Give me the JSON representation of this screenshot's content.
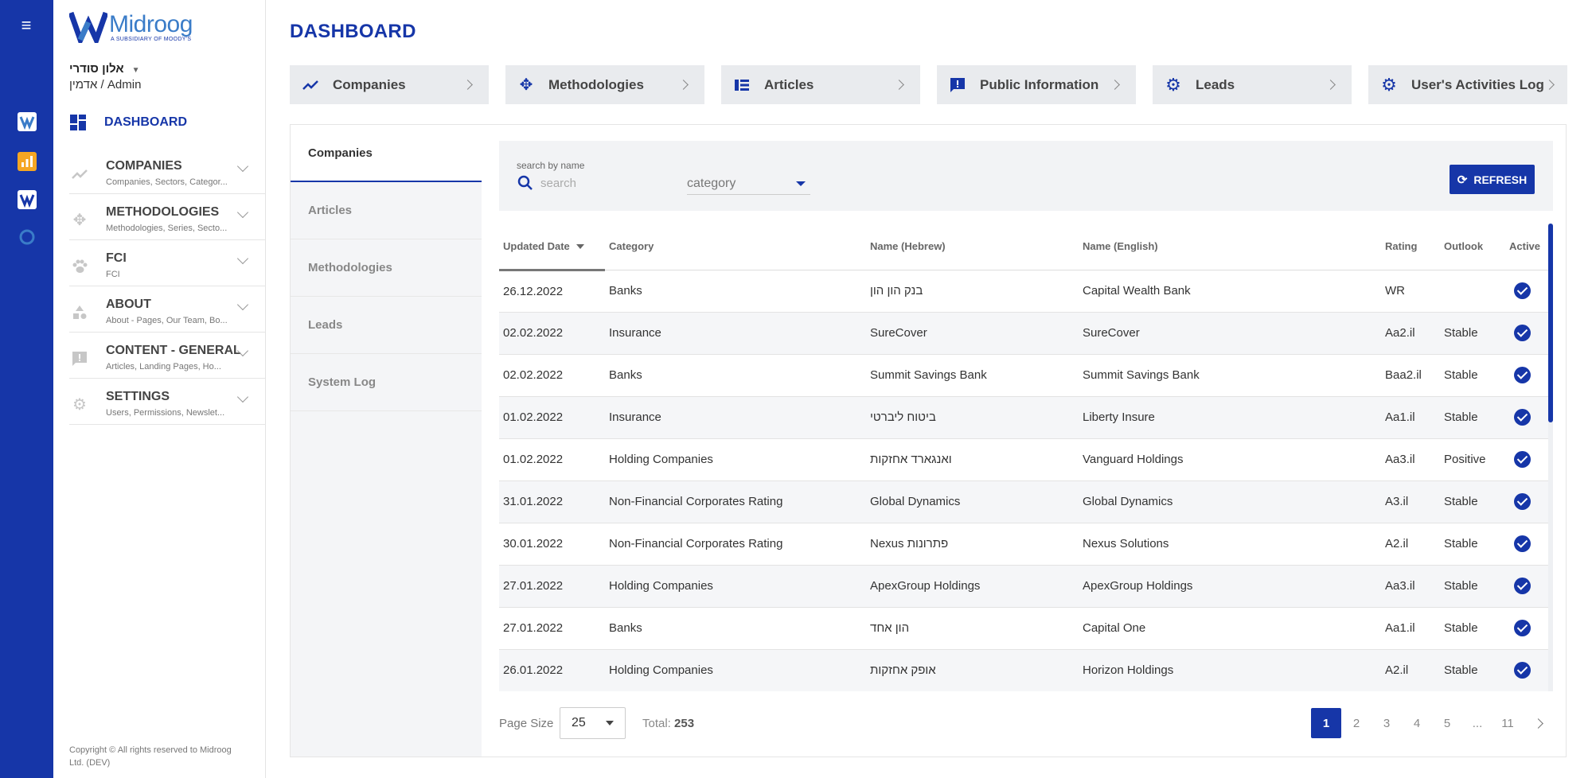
{
  "brand": {
    "name": "Midroog",
    "tagline": "A SUBSIDIARY OF MOODY'S"
  },
  "user": {
    "name": "אלון סודרי",
    "role": "אדמין / Admin"
  },
  "sidebar": {
    "dashboard_label": "DASHBOARD",
    "items": [
      {
        "title": "COMPANIES",
        "subtitle": "Companies, Sectors, Categor...",
        "icon": "trend-line-icon"
      },
      {
        "title": "METHODOLOGIES",
        "subtitle": "Methodologies, Series, Secto...",
        "icon": "move-arrows-icon"
      },
      {
        "title": "FCI",
        "subtitle": "FCI",
        "icon": "paw-icon"
      },
      {
        "title": "ABOUT",
        "subtitle": "About - Pages, Our Team, Bo...",
        "icon": "shapes-icon"
      },
      {
        "title": "CONTENT - GENERAL",
        "subtitle": "Articles, Landing Pages, Ho...",
        "icon": "alert-comment-icon"
      },
      {
        "title": "SETTINGS",
        "subtitle": "Users, Permissions, Newslet...",
        "icon": "gear-icon"
      }
    ],
    "copyright": "Copyright © All rights reserved to Midroog Ltd. (DEV)"
  },
  "page_title": "DASHBOARD",
  "quick_links": [
    {
      "label": "Companies",
      "icon": "trend-line-icon"
    },
    {
      "label": "Methodologies",
      "icon": "move-arrows-icon"
    },
    {
      "label": "Articles",
      "icon": "list-icon"
    },
    {
      "label": "Public Information",
      "icon": "alert-comment-icon"
    },
    {
      "label": "Leads",
      "icon": "gear-icon"
    },
    {
      "label": "User's Activities Log",
      "icon": "gear-icon"
    }
  ],
  "tabs": [
    "Companies",
    "Articles",
    "Methodologies",
    "Leads",
    "System Log"
  ],
  "filters": {
    "search_label": "search by name",
    "search_placeholder": "search",
    "category_placeholder": "category",
    "refresh_label": "REFRESH"
  },
  "table": {
    "columns": [
      "Updated Date",
      "Category",
      "Name (Hebrew)",
      "Name (English)",
      "Rating",
      "Outlook",
      "Active"
    ],
    "rows": [
      [
        "26.12.2022",
        "Banks",
        "בנק הון הון",
        "Capital Wealth Bank",
        "WR",
        "",
        true
      ],
      [
        "02.02.2022",
        "Insurance",
        "SureCover",
        "SureCover",
        "Aa2.il",
        "Stable",
        true
      ],
      [
        "02.02.2022",
        "Banks",
        "Summit Savings Bank",
        "Summit Savings Bank",
        "Baa2.il",
        "Stable",
        true
      ],
      [
        "01.02.2022",
        "Insurance",
        "ביטוח ליברטי",
        "Liberty Insure",
        "Aa1.il",
        "Stable",
        true
      ],
      [
        "01.02.2022",
        "Holding Companies",
        "ואנגארד אחזקות",
        "Vanguard Holdings",
        "Aa3.il",
        "Positive",
        true
      ],
      [
        "31.01.2022",
        "Non-Financial Corporates Rating",
        "Global Dynamics",
        "Global Dynamics",
        "A3.il",
        "Stable",
        true
      ],
      [
        "30.01.2022",
        "Non-Financial Corporates Rating",
        "Nexus פתרונות",
        "Nexus Solutions",
        "A2.il",
        "Stable",
        true
      ],
      [
        "27.01.2022",
        "Holding Companies",
        "ApexGroup Holdings",
        "ApexGroup Holdings",
        "Aa3.il",
        "Stable",
        true
      ],
      [
        "27.01.2022",
        "Banks",
        "הון אחד",
        "Capital One",
        "Aa1.il",
        "Stable",
        true
      ],
      [
        "26.01.2022",
        "Holding Companies",
        "אופק אחזקות",
        "Horizon Holdings",
        "A2.il",
        "Stable",
        true
      ]
    ]
  },
  "pagination": {
    "page_size_label": "Page Size",
    "page_size": "25",
    "total_label": "Total:",
    "total": "253",
    "pages": [
      "1",
      "2",
      "3",
      "4",
      "5",
      "...",
      "11"
    ],
    "current": "1"
  },
  "colors": {
    "primary": "#1636a8",
    "logo_blue": "#3a7cc8"
  }
}
